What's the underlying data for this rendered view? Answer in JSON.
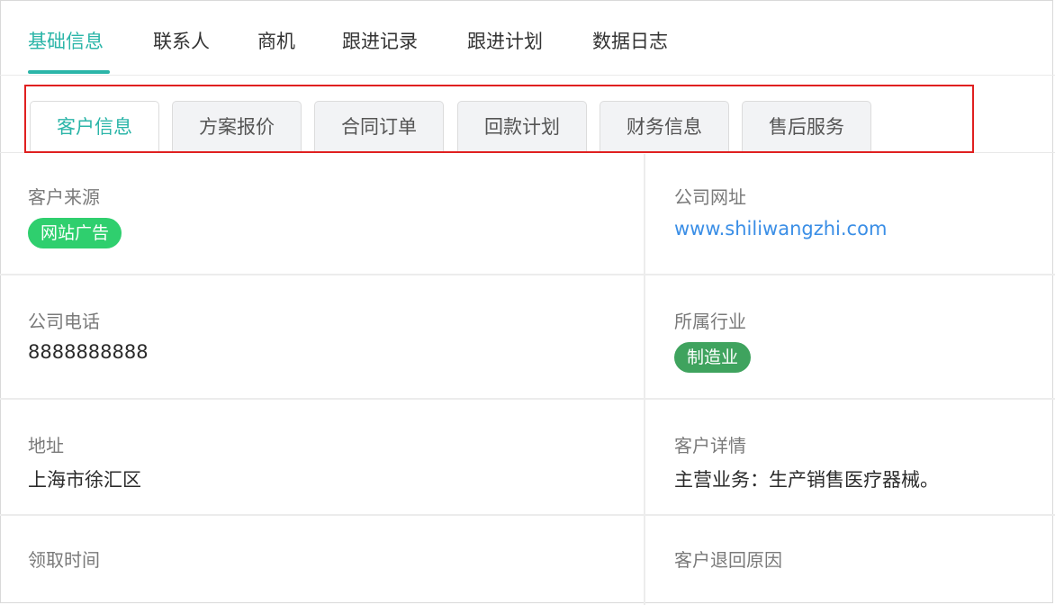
{
  "top_tabs": [
    "基础信息",
    "联系人",
    "商机",
    "跟进记录",
    "跟进计划",
    "数据日志"
  ],
  "sub_tabs": [
    "客户信息",
    "方案报价",
    "合同订单",
    "回款计划",
    "财务信息",
    "售后服务"
  ],
  "fields": {
    "source": {
      "label": "客户来源",
      "value": "网站广告"
    },
    "website": {
      "label": "公司网址",
      "value": "www.shiliwangzhi.com"
    },
    "phone": {
      "label": "公司电话",
      "value": "8888888888"
    },
    "industry": {
      "label": "所属行业",
      "value": "制造业"
    },
    "address": {
      "label": "地址",
      "value": "上海市徐汇区"
    },
    "details": {
      "label": "客户详情",
      "value": "主营业务：生产销售医疗器械。"
    },
    "claim_time": {
      "label": "领取时间",
      "value": ""
    },
    "return_reason": {
      "label": "客户退回原因",
      "value": ""
    }
  },
  "colors": {
    "accent": "#2bb5a8",
    "source_tag": "#2fcf6e",
    "industry_tag": "#3fa35e",
    "link": "#3a8ee6",
    "highlight": "#e02020"
  }
}
